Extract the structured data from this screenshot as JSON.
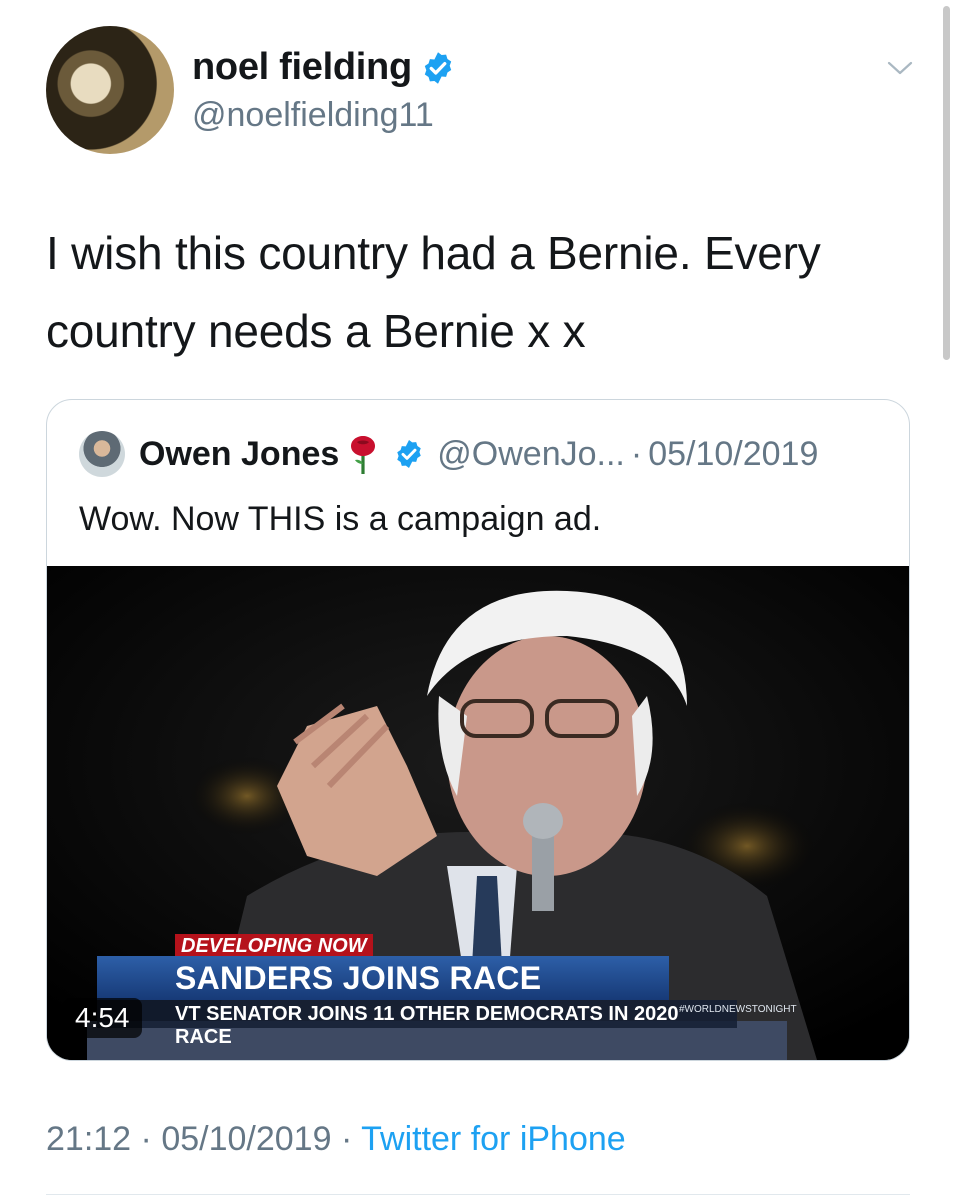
{
  "author": {
    "display_name": "noel fielding",
    "handle": "@noelfielding11",
    "verified": true
  },
  "tweet": {
    "text_line1": "I wish this country had a Bernie. Every",
    "text_line2": "country needs a Bernie x x"
  },
  "quoted_tweet": {
    "display_name": "Owen Jones",
    "emoji": "rose",
    "verified": true,
    "handle": "@OwenJo...",
    "separator": "·",
    "date": "05/10/2019",
    "text": "Wow. Now THIS is a campaign ad.",
    "video": {
      "duration": "4:54",
      "lower_third_label": "DEVELOPING NOW",
      "headline": "SANDERS JOINS RACE",
      "subheadline": "VT SENATOR JOINS 11 OTHER DEMOCRATS IN 2020 RACE",
      "network_tag": "#WORLDNEWSTONIGHT"
    }
  },
  "footer": {
    "time": "21:12",
    "dot1": "·",
    "date": "05/10/2019",
    "dot2": "·",
    "app": "Twitter for iPhone"
  },
  "colors": {
    "verified_badge": "#1da1f2",
    "secondary_text": "#657786",
    "link": "#1da1f2",
    "ticker_red": "#b5121b",
    "ticker_blue": "#2d5fa8"
  }
}
